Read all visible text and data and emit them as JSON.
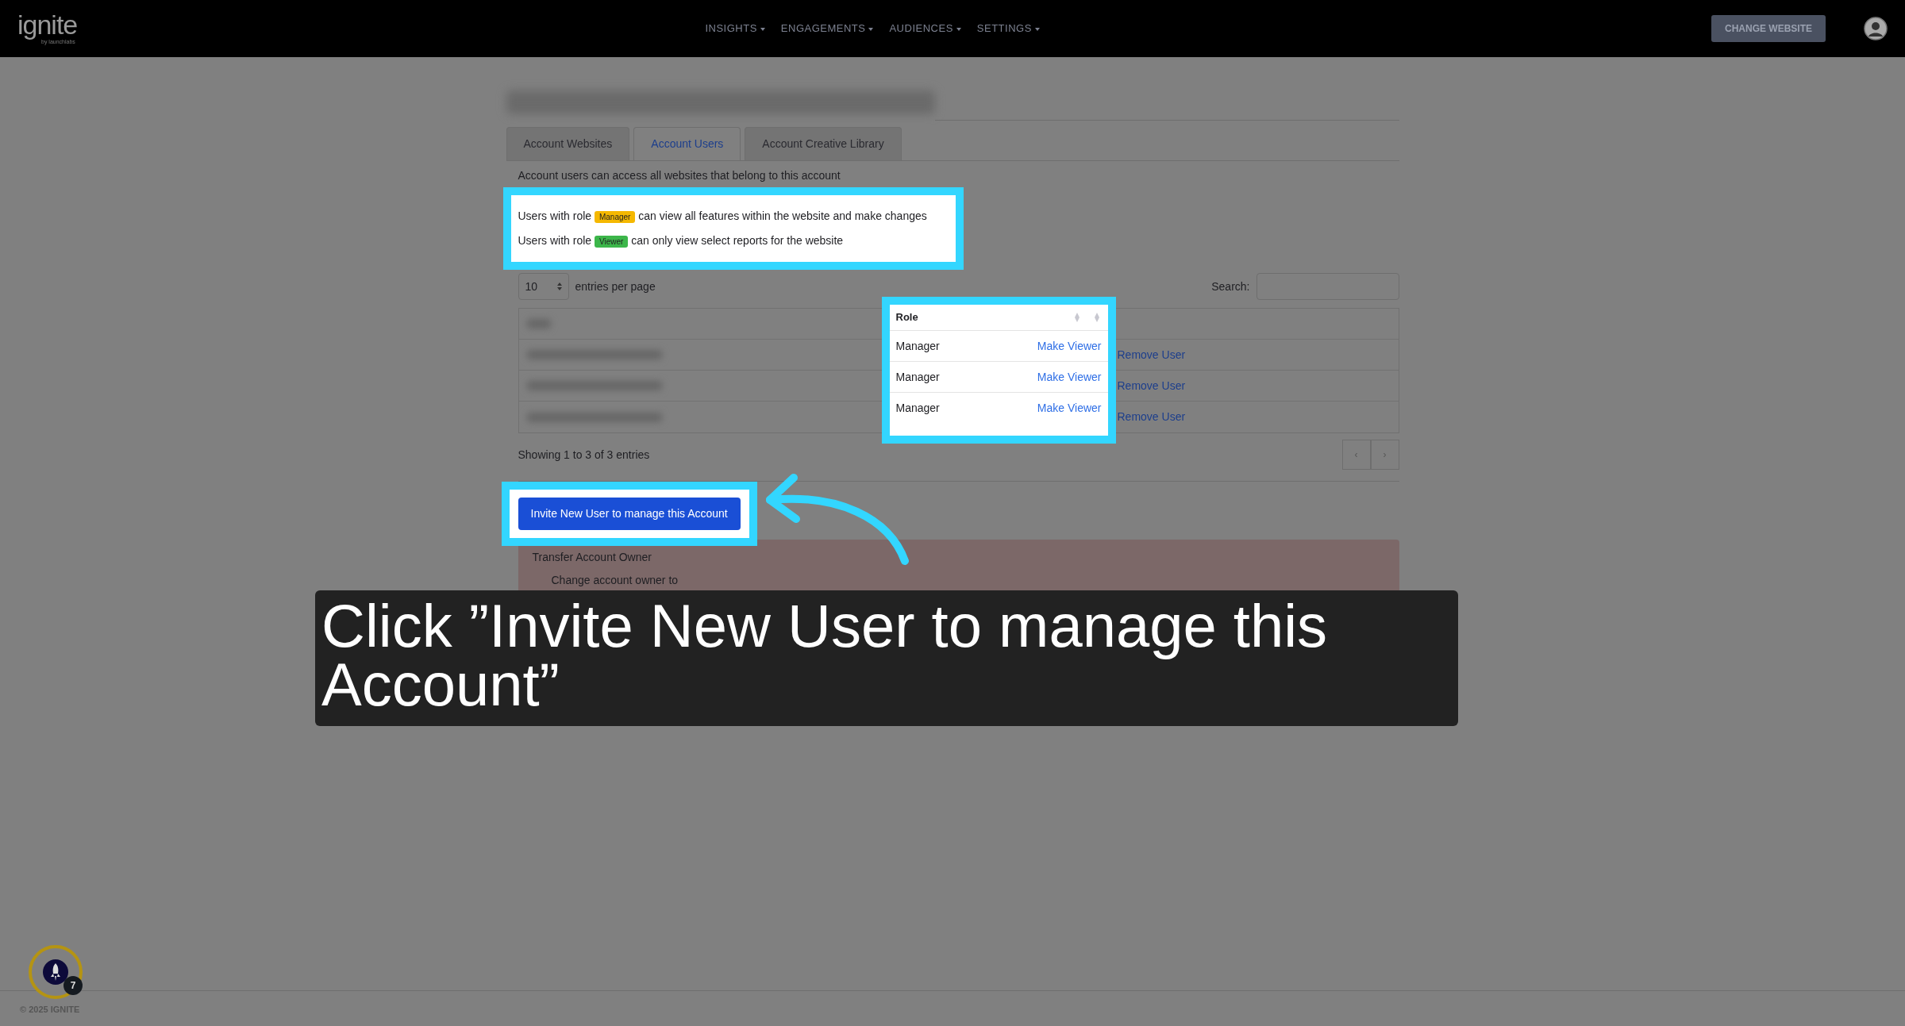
{
  "brand": {
    "logo": "ignite",
    "tagline": "by launchlabs"
  },
  "nav": {
    "items": [
      {
        "label": "INSIGHTS"
      },
      {
        "label": "ENGAGEMENTS"
      },
      {
        "label": "AUDIENCES"
      },
      {
        "label": "SETTINGS"
      }
    ],
    "button": "CHANGE WEBSITE"
  },
  "tabs": [
    {
      "label": "Account Websites",
      "selected": false
    },
    {
      "label": "Account Users",
      "selected": true
    },
    {
      "label": "Account Creative Library",
      "selected": false
    }
  ],
  "intro": "Account users can access all websites that belong to this account",
  "roles": [
    {
      "before": "Users with role",
      "badge": "Manager",
      "color": "#f5b800",
      "after": "can view all features within the website and make changes"
    },
    {
      "before": "Users with role",
      "badge": "Viewer",
      "color": "#3cb64a",
      "after": "can only view select reports for the website"
    }
  ],
  "length_select": "10",
  "entries_label": "entries per page",
  "search_label": "Search:",
  "table": {
    "columns": [
      {
        "label": "Role"
      }
    ],
    "rows": [
      {
        "role": "Manager",
        "actions": [
          "Make Viewer",
          "Remove User"
        ]
      },
      {
        "role": "Manager",
        "actions": [
          "Make Viewer",
          "Remove User"
        ]
      },
      {
        "role": "Manager",
        "actions": [
          "Make Viewer",
          "Remove User"
        ]
      }
    ]
  },
  "info": "Showing 1 to 3 of 3 entries",
  "pagination": [
    "‹",
    "›"
  ],
  "invite_button": "Invite New User to manage this Account",
  "transfer": {
    "title": "Transfer Account Owner",
    "label": "Change account owner to"
  },
  "caption": "Click ”Invite New User to manage this Account”",
  "footer": {
    "copyright": "© 2025 IGNITE",
    "badge": "7"
  }
}
